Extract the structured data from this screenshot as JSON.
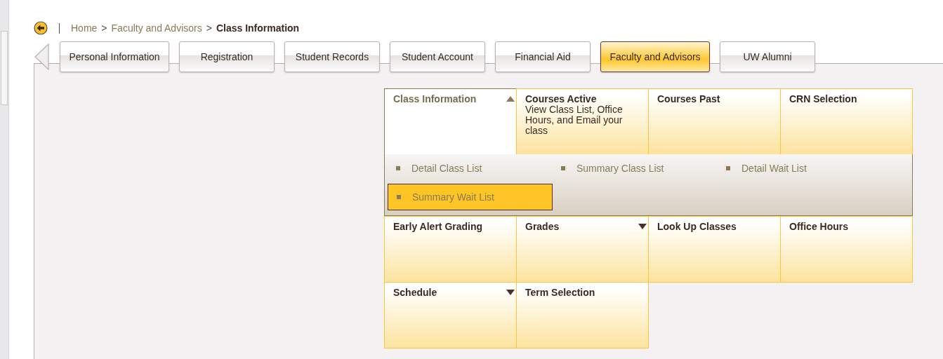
{
  "breadcrumb": {
    "items": [
      {
        "label": "Home",
        "current": false
      },
      {
        "label": "Faculty and Advisors",
        "current": false
      },
      {
        "label": "Class Information",
        "current": true
      }
    ],
    "separator": ">"
  },
  "tabs": [
    {
      "label": "Personal Information",
      "selected": false
    },
    {
      "label": "Registration",
      "selected": false
    },
    {
      "label": "Student Records",
      "selected": false
    },
    {
      "label": "Student Account",
      "selected": false
    },
    {
      "label": "Financial Aid",
      "selected": false
    },
    {
      "label": "Faculty and Advisors",
      "selected": true
    },
    {
      "label": "UW Alumni",
      "selected": false
    }
  ],
  "tile_rows": [
    [
      {
        "title": "Class Information",
        "kind": "menu",
        "expanded": true,
        "submenu": [
          {
            "label": "Detail Class List",
            "selected": false
          },
          {
            "label": "Summary Class List",
            "selected": false
          },
          {
            "label": "Detail Wait List",
            "selected": false
          },
          {
            "label": "Summary Wait List",
            "selected": true
          }
        ]
      },
      {
        "title": "Courses Active",
        "description": "View Class List, Office Hours, and Email your class",
        "kind": "link",
        "expanded": false
      },
      {
        "title": "Courses Past",
        "kind": "link",
        "expanded": false
      },
      {
        "title": "CRN Selection",
        "kind": "link",
        "expanded": false
      }
    ],
    [
      {
        "title": "Early Alert Grading",
        "kind": "link",
        "expanded": false
      },
      {
        "title": "Grades",
        "kind": "menu",
        "expanded": false
      },
      {
        "title": "Look Up Classes",
        "kind": "link",
        "expanded": false
      },
      {
        "title": "Office Hours",
        "kind": "link",
        "expanded": false
      }
    ],
    [
      {
        "title": "Schedule",
        "kind": "menu",
        "expanded": false
      },
      {
        "title": "Term Selection",
        "kind": "link",
        "expanded": false
      }
    ]
  ]
}
